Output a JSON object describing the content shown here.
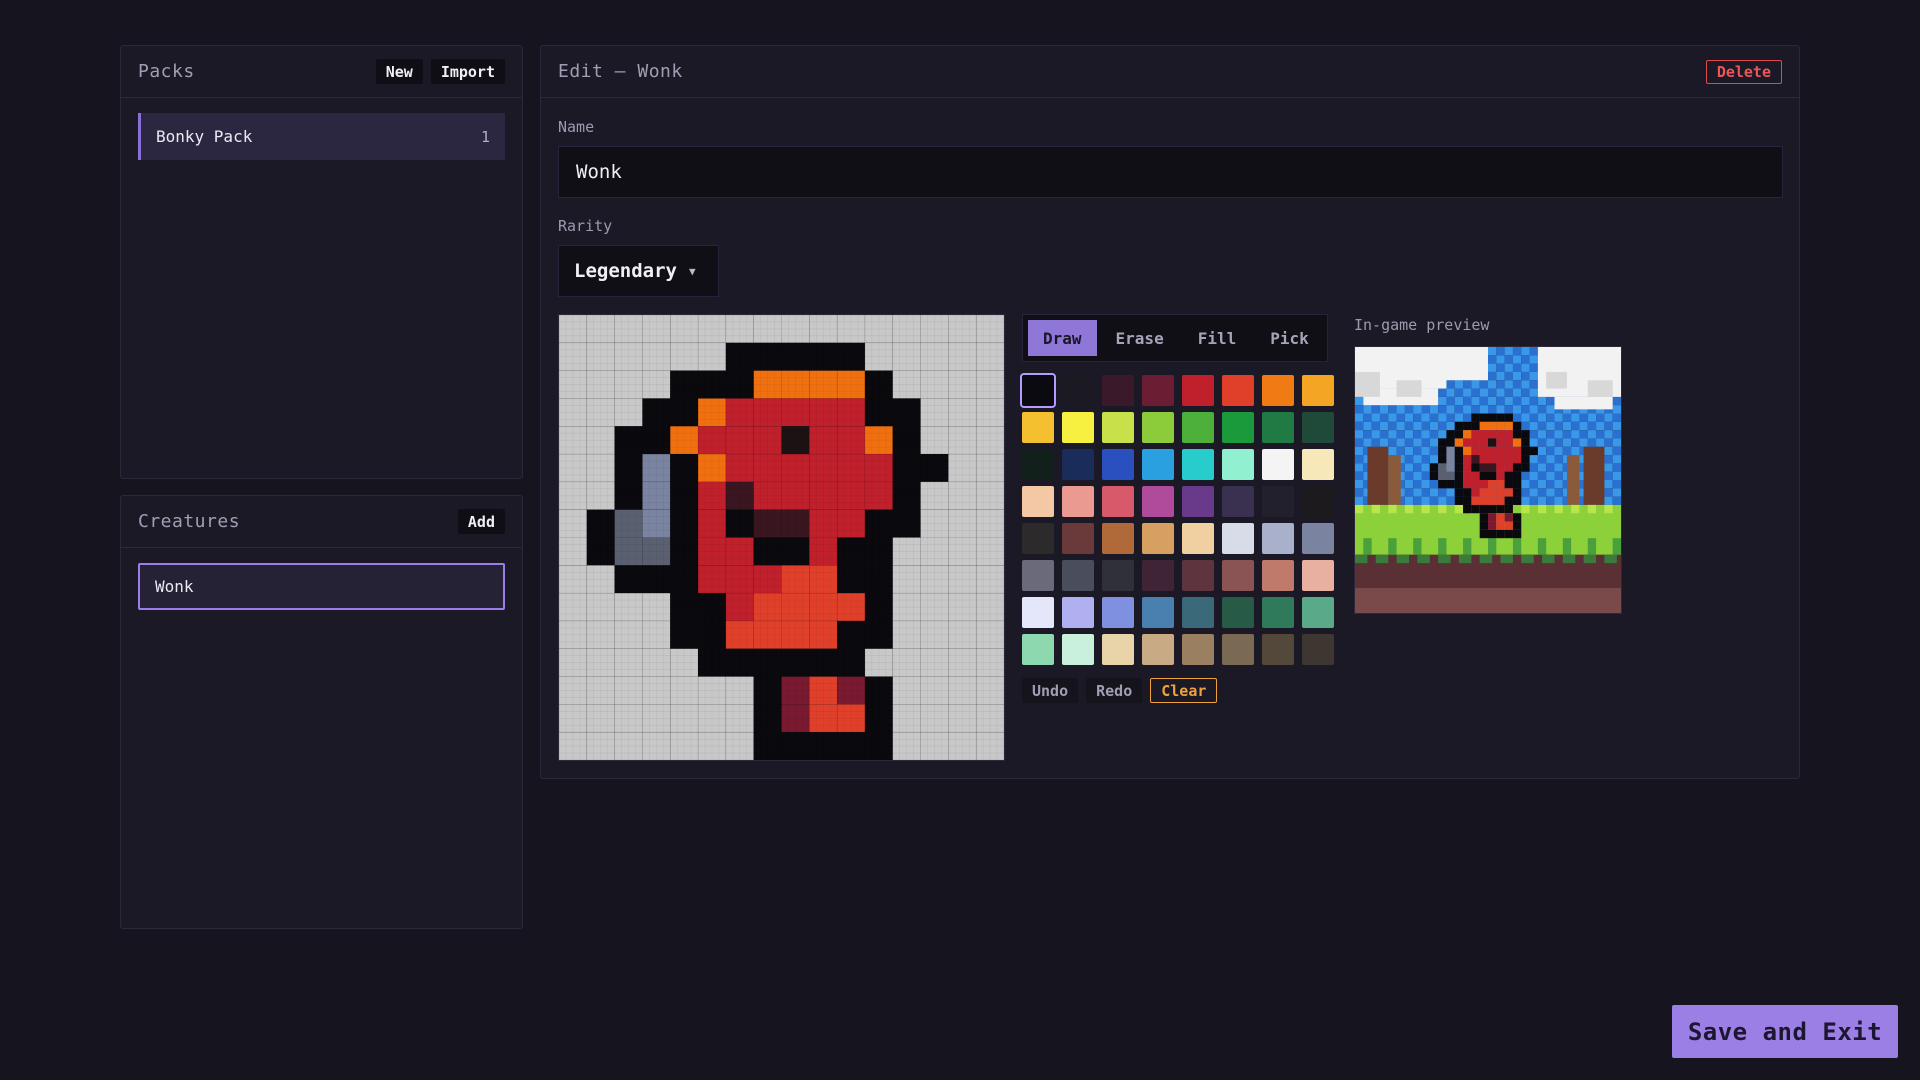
{
  "packs": {
    "title": "Packs",
    "new_label": "New",
    "import_label": "Import",
    "items": [
      {
        "name": "Bonky Pack",
        "count": "1"
      }
    ]
  },
  "creatures": {
    "title": "Creatures",
    "add_label": "Add",
    "items": [
      {
        "name": "Wonk"
      }
    ]
  },
  "editor": {
    "title": "Edit — Wonk",
    "delete_label": "Delete",
    "name_label": "Name",
    "name_value": "Wonk",
    "rarity_label": "Rarity",
    "rarity_value": "Legendary",
    "tools": [
      "Draw",
      "Erase",
      "Fill",
      "Pick"
    ],
    "active_tool": "Draw",
    "palette": [
      "#0b0a10",
      "#1b1a22",
      "#3a1a2a",
      "#6b1e33",
      "#c0202b",
      "#e0402a",
      "#f07a14",
      "#f5a524",
      "#f5c030",
      "#f7f040",
      "#c8e04a",
      "#8ccc3a",
      "#4cb03a",
      "#1a9a3a",
      "#1f7a44",
      "#1f4a3a",
      "#12201c",
      "#1a2c5a",
      "#2a50c0",
      "#2aa0e0",
      "#28cccc",
      "#90f0d0",
      "#f4f4f4",
      "#f6e8b8",
      "#f4c8a4",
      "#ea9a90",
      "#d85a6a",
      "#b04a9a",
      "#6a3a8a",
      "#3a3050",
      "#22202c",
      "#1c1a1c",
      "#2c2a2a",
      "#6a3a3a",
      "#b06a3a",
      "#d8a060",
      "#f0d0a0",
      "#d8dce8",
      "#a8b0cc",
      "#7a84a0",
      "#6a6a7a",
      "#4a4e5c",
      "#303038",
      "#3e2434",
      "#5e343e",
      "#8a5454",
      "#c07a6c",
      "#e8b0a0",
      "#e4e6fa",
      "#b0b0f0",
      "#8090e0",
      "#4a80b0",
      "#3a6a7a",
      "#285a48",
      "#2e7a5a",
      "#5aaa8a",
      "#8ed8b0",
      "#c8f0dc",
      "#e8d4a8",
      "#c8aa84",
      "#9a8060",
      "#7a6a54",
      "#54483a",
      "#3e3630"
    ],
    "selected_color": "#0b0a10",
    "undo_label": "Undo",
    "redo_label": "Redo",
    "clear_label": "Clear",
    "preview_label": "In-game preview",
    "pixel_palette": {
      ".": "#c8c8c8",
      "K": "#0a090d",
      "O": "#f07010",
      "R": "#c0202b",
      "D": "#e0402a",
      "M": "#7a1a30",
      "E": "#3a1620",
      "N": "#1c1214",
      "G": "#7a84a0",
      "S": "#5a6070"
    },
    "pixel_rows": [
      "................",
      "......KKKKK.....",
      "....KKKOOOOK....",
      "...KKORRRRRKK...",
      "..KKORRRNRROK...",
      "..KGKORRRRRRKK..",
      "..KGKRERRRRRK...",
      ".KSGKRKEERRKK...",
      ".KSSKRRKKRKK....",
      "..KKKRRRDDKK....",
      "....KKRDDDDK....",
      "....KKDDDDKK....",
      ".....KKKKKK.....",
      ".......KMDMK....",
      ".......KMDDK....",
      ".......KKKKK...."
    ]
  },
  "save_label": "Save and Exit"
}
